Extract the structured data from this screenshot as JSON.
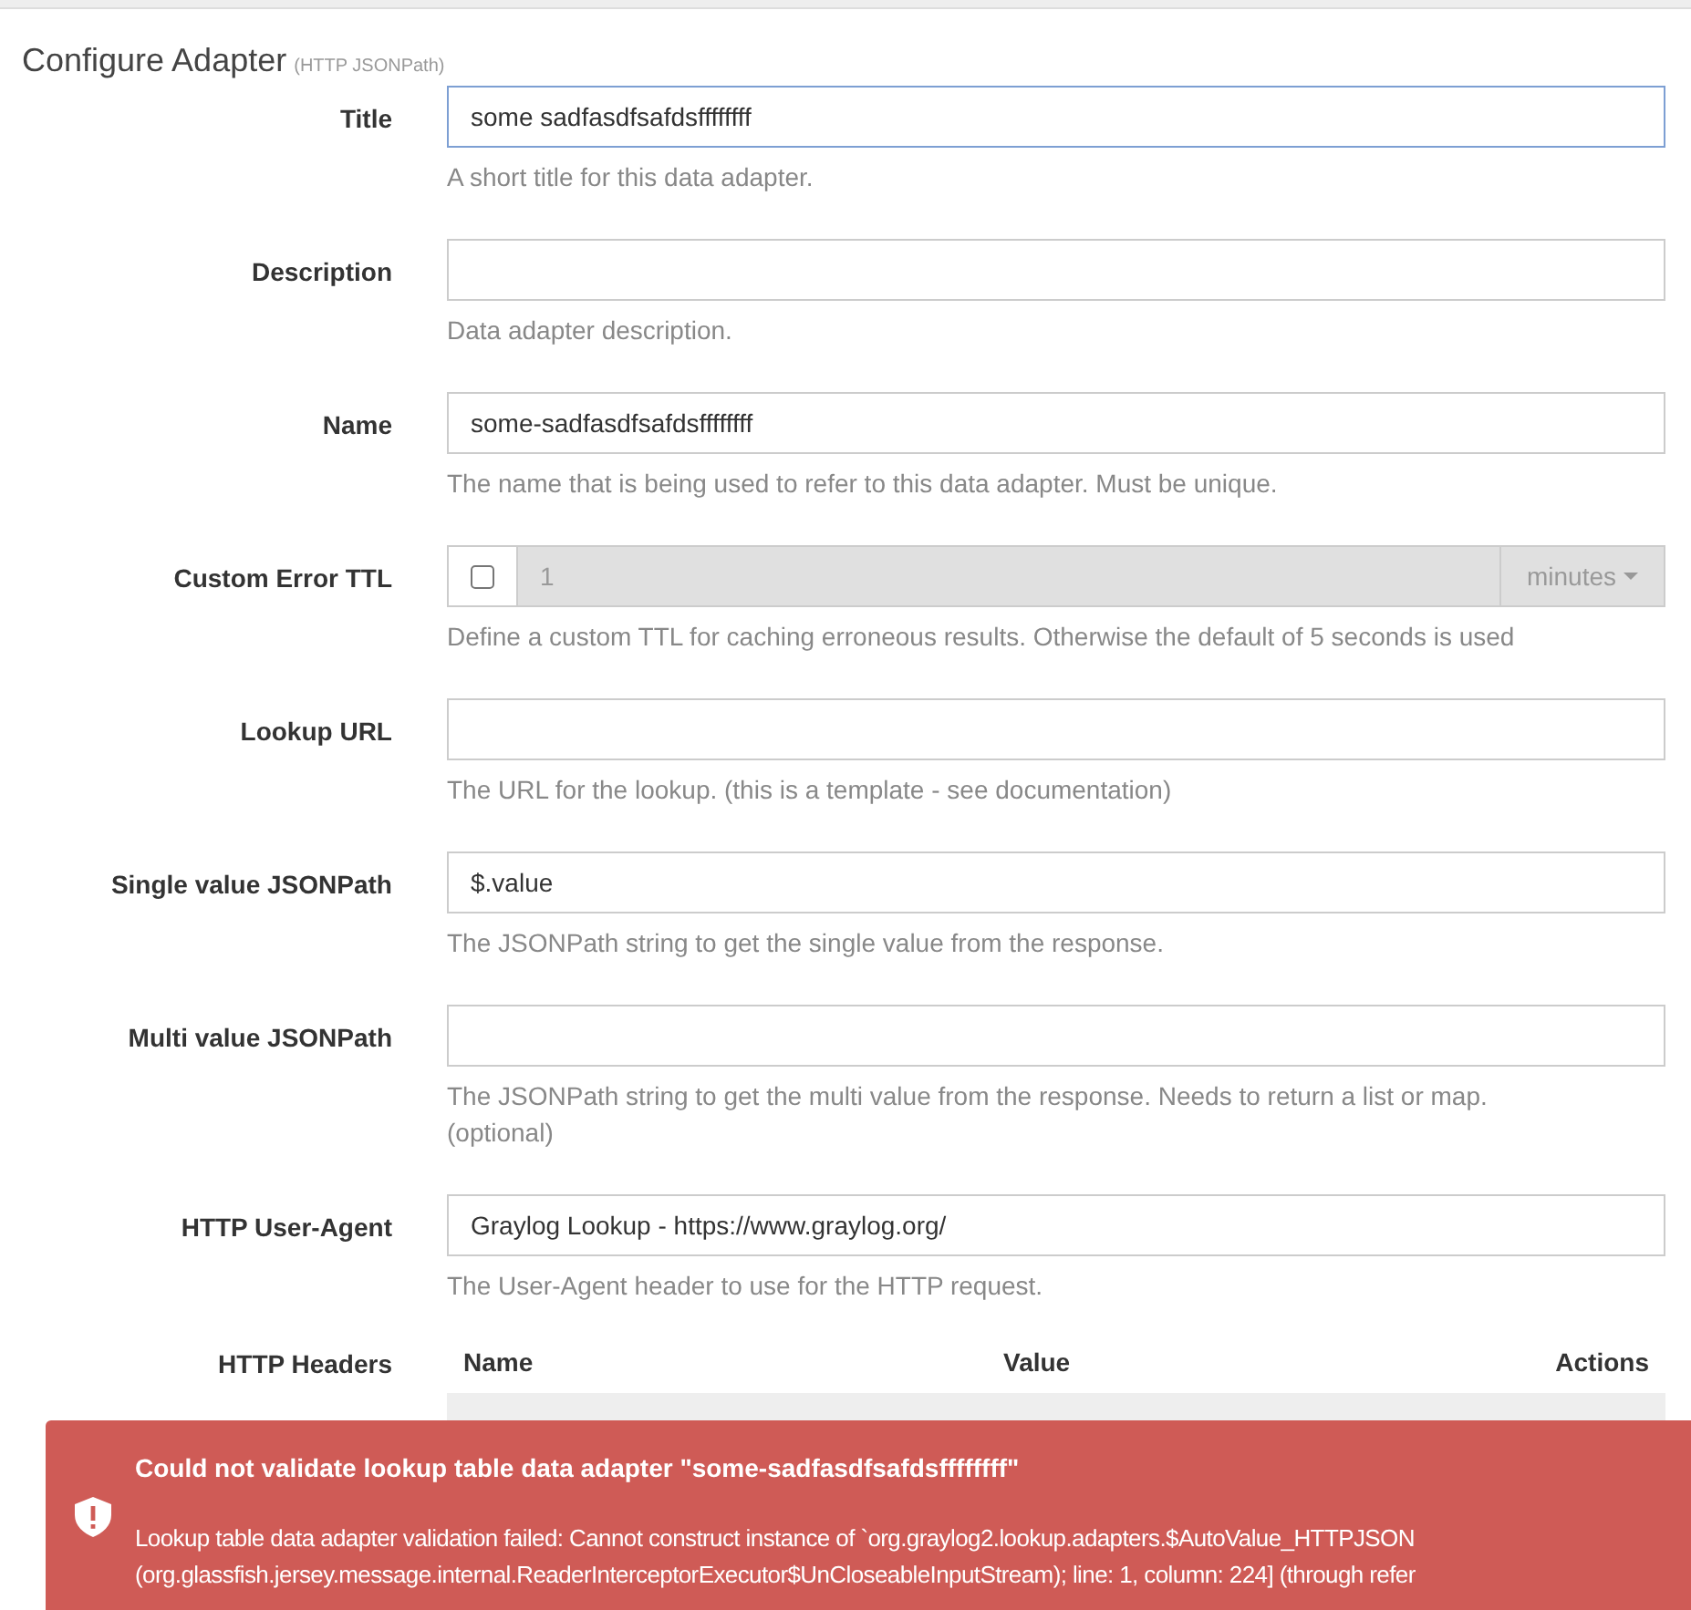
{
  "heading": {
    "title": "Configure Adapter",
    "subtitle": "(HTTP JSONPath)"
  },
  "fields": [
    {
      "kind": "text",
      "label": "Title",
      "value": "some sadfasdfsafdsffffffff",
      "focused": true,
      "help": "A short title for this data adapter."
    },
    {
      "kind": "text",
      "label": "Description",
      "focused": false,
      "help": "Data adapter description."
    },
    {
      "kind": "text",
      "label": "Name",
      "value": "some-sadfasdfsafdsffffffff",
      "focused": false,
      "help": "The name that is being used to refer to this data adapter. Must be unique."
    },
    {
      "kind": "ttl",
      "label": "Custom Error TTL",
      "checked": false,
      "value": "1",
      "unit": "minutes",
      "help": "Define a custom TTL for caching erroneous results. Otherwise the default of 5 seconds is used"
    },
    {
      "kind": "text",
      "label": "Lookup URL",
      "focused": false,
      "help": "The URL for the lookup. (this is a template - see documentation)"
    },
    {
      "kind": "text",
      "label": "Single value JSONPath",
      "value": "$.value",
      "focused": false,
      "help": "The JSONPath string to get the single value from the response."
    },
    {
      "kind": "text",
      "label": "Multi value JSONPath",
      "focused": false,
      "help": "The JSONPath string to get the multi value from the response. Needs to return a list or map. (optional)"
    },
    {
      "kind": "text",
      "label": "HTTP User-Agent",
      "value": "Graylog Lookup - https://www.graylog.org/",
      "focused": false,
      "help": "The User-Agent header to use for the HTTP request."
    }
  ],
  "headers": {
    "label": "HTTP Headers",
    "columns": [
      "Name",
      "Value",
      "Actions"
    ]
  },
  "alert": {
    "title": "Could not validate lookup table data adapter \"some-sadfasdfsafdsffffffff\"",
    "lines": [
      "Lookup table data adapter validation failed: Cannot construct instance of `org.graylog2.lookup.adapters.$AutoValue_HTTPJSON",
      "(org.glassfish.jersey.message.internal.ReaderInterceptorExecutor$UnCloseableInputStream); line: 1, column: 224] (through refer"
    ]
  }
}
